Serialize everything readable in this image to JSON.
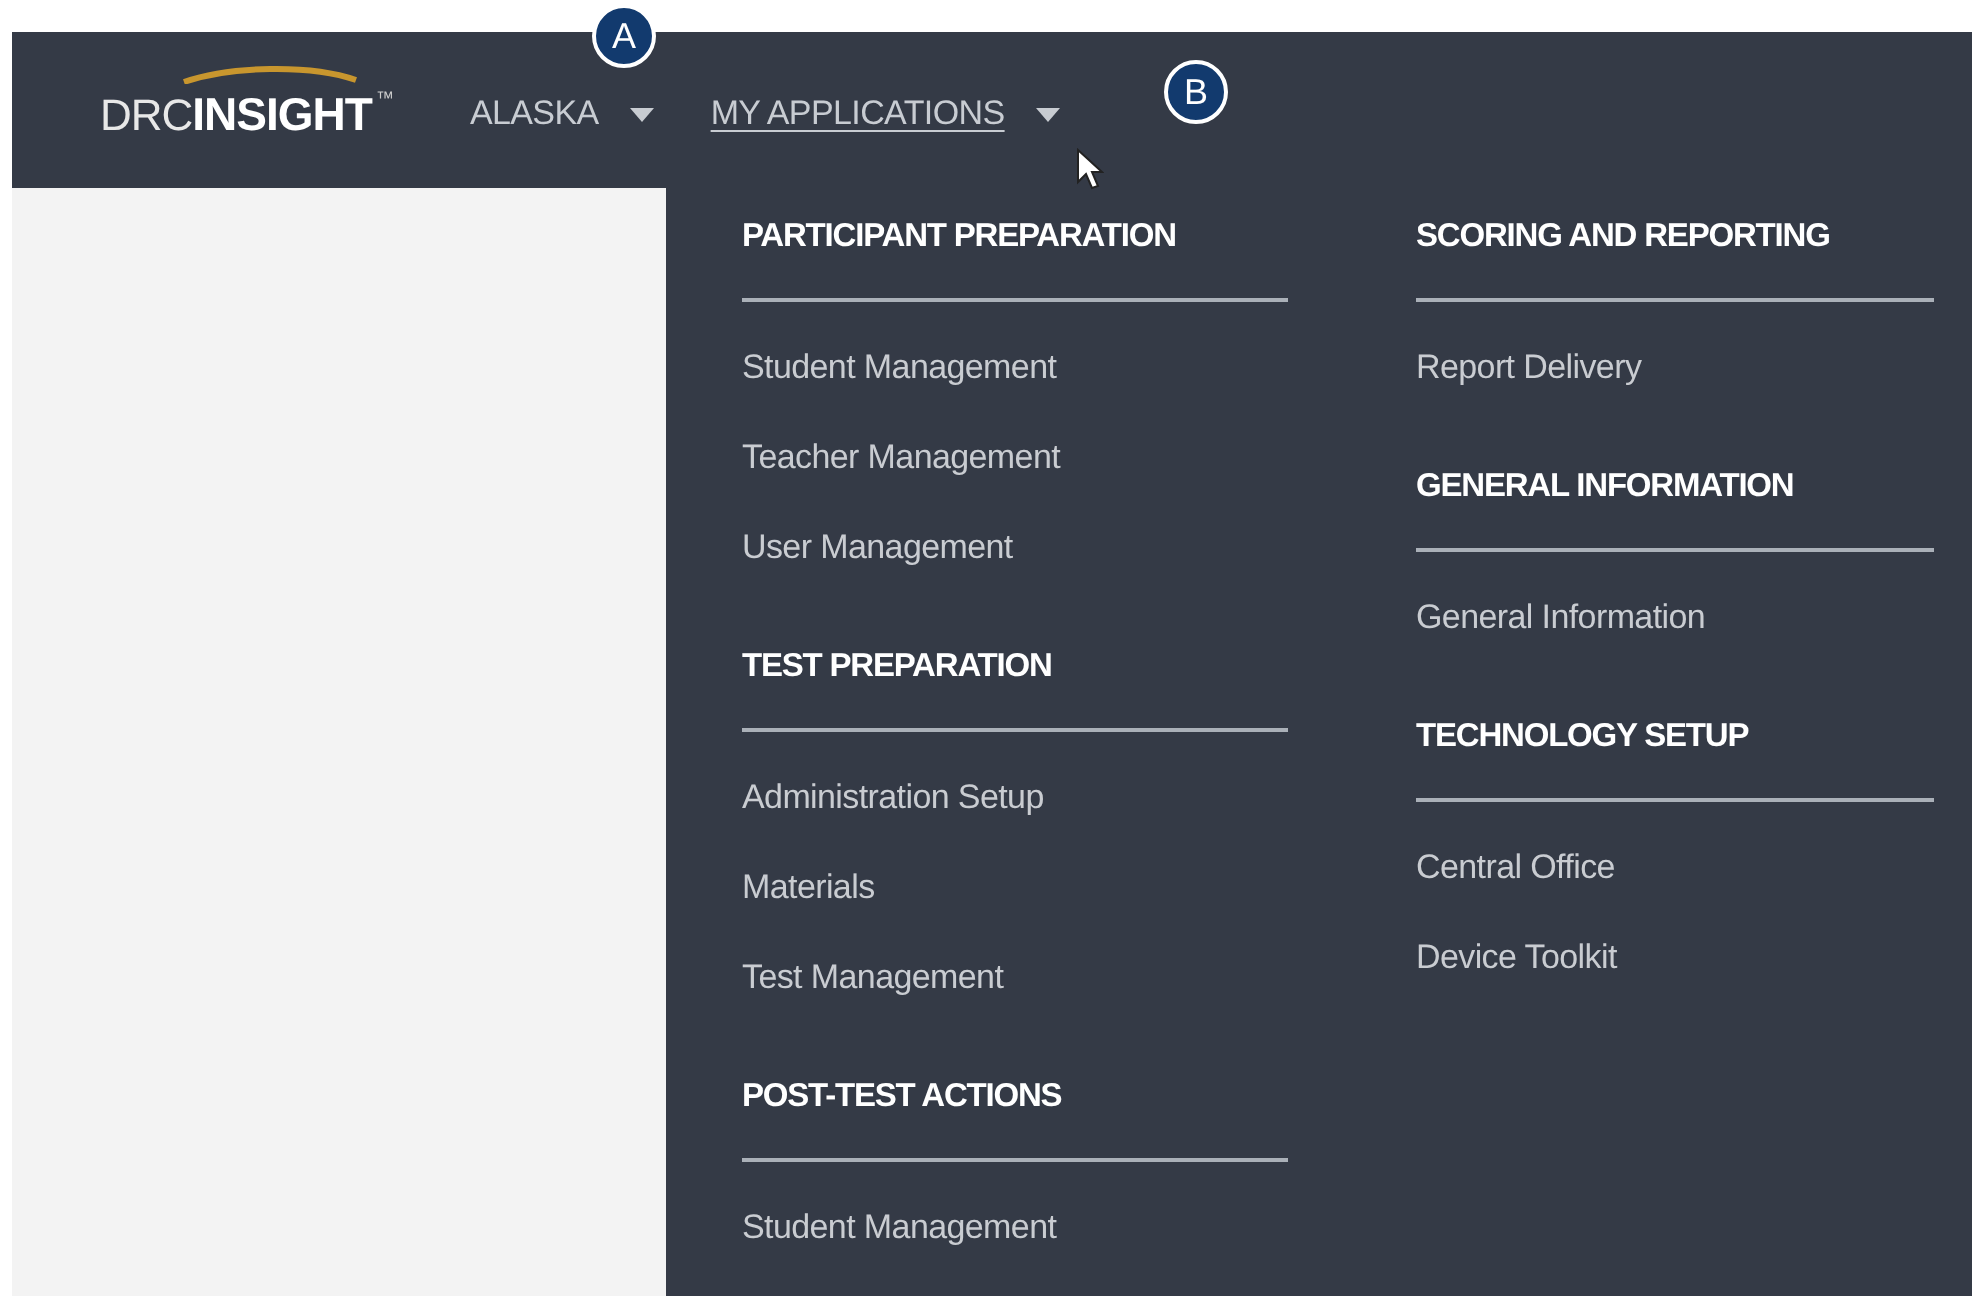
{
  "header": {
    "logo": {
      "text_1": "DRC",
      "text_2": "INSIGHT",
      "mark": "™"
    },
    "nav": [
      {
        "label": "ALASKA",
        "selected": false
      },
      {
        "label": "MY APPLICATIONS",
        "selected": true
      }
    ]
  },
  "callouts": [
    {
      "label": "A"
    },
    {
      "label": "B"
    }
  ],
  "menu": {
    "columns": [
      {
        "sections": [
          {
            "heading": "PARTICIPANT PREPARATION",
            "items": [
              "Student Management",
              "Teacher Management",
              "User Management"
            ]
          },
          {
            "heading": "TEST PREPARATION",
            "items": [
              "Administration Setup",
              "Materials",
              "Test Management"
            ]
          },
          {
            "heading": "POST-TEST ACTIONS",
            "items": [
              "Student Management"
            ]
          }
        ]
      },
      {
        "sections": [
          {
            "heading": "SCORING AND REPORTING",
            "items": [
              "Report Delivery"
            ]
          },
          {
            "heading": "GENERAL INFORMATION",
            "items": [
              "General Information"
            ]
          },
          {
            "heading": "TECHNOLOGY SETUP",
            "items": [
              "Central Office",
              "Device Toolkit"
            ]
          }
        ]
      }
    ]
  }
}
